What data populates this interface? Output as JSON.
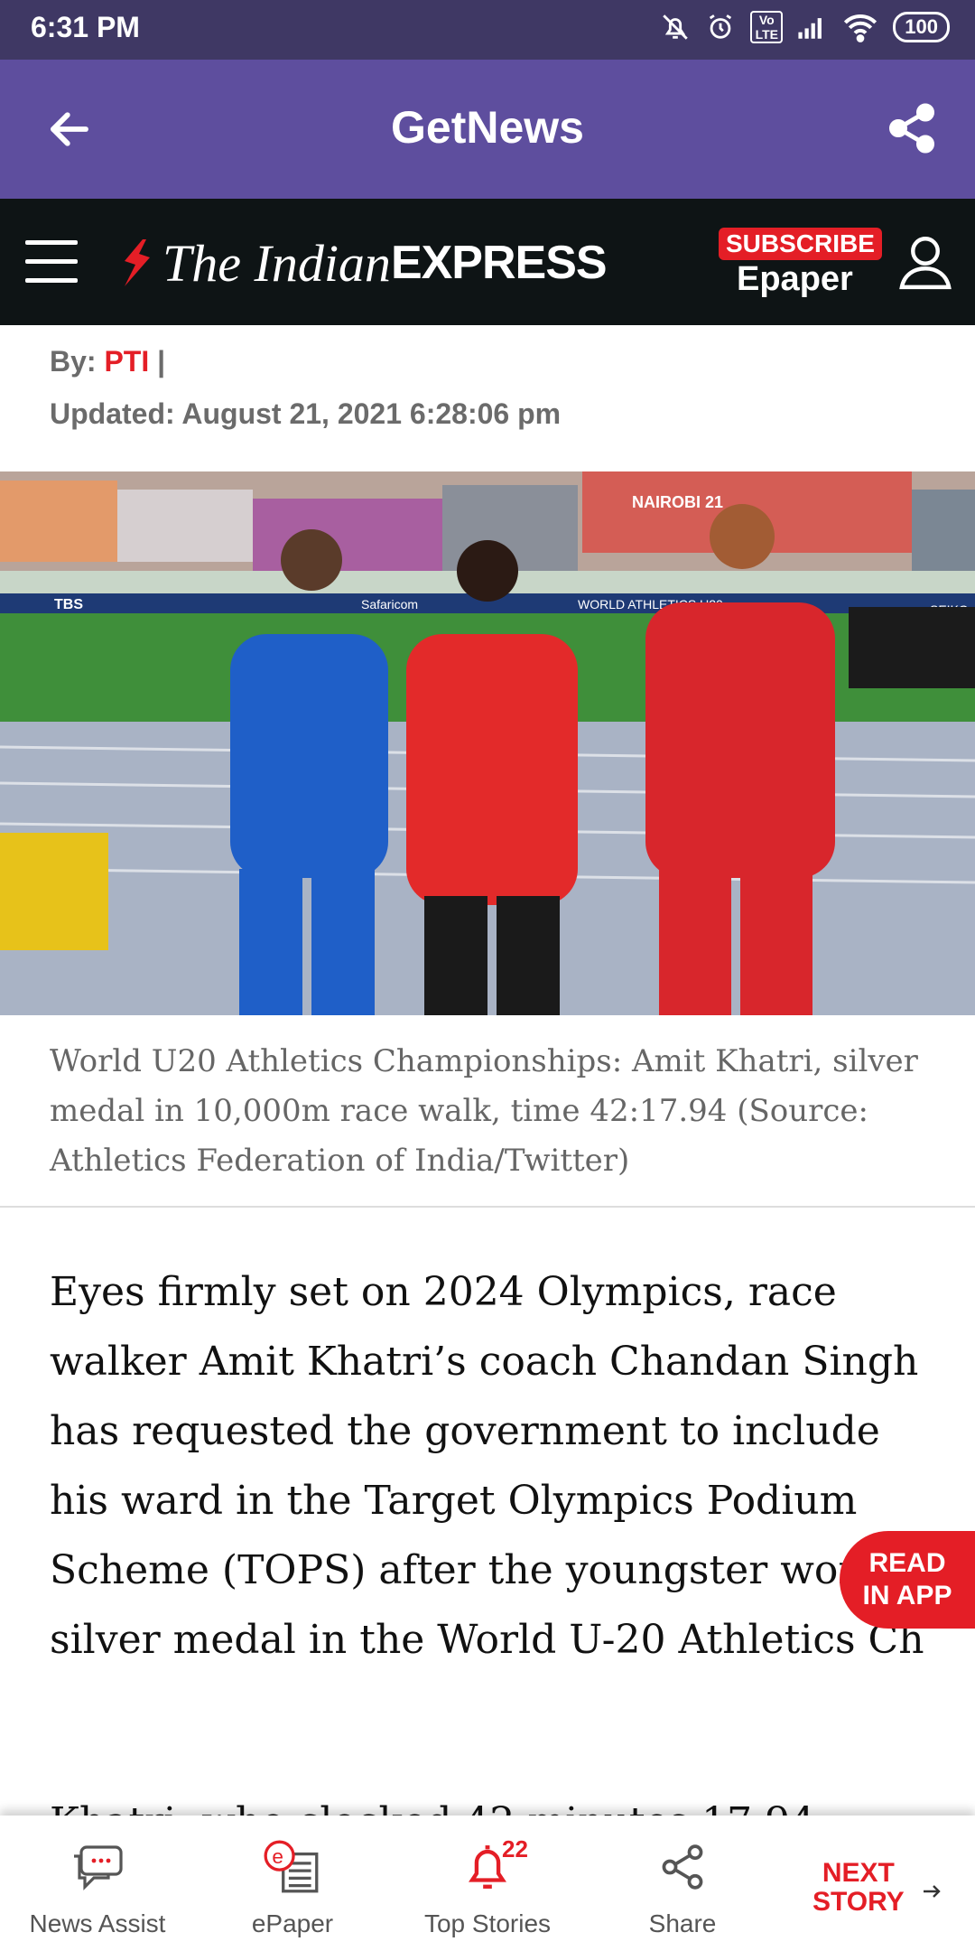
{
  "status_bar": {
    "time": "6:31 PM",
    "battery": "100",
    "network": "Vo LTE"
  },
  "app_bar": {
    "title": "GetNews"
  },
  "publisher_header": {
    "logo_the": "The Indian",
    "logo_express": "EXPRESS",
    "subscribe_label": "SUBSCRIBE",
    "epaper_label": "Epaper"
  },
  "article_meta": {
    "by_label": "By:",
    "author": "PTI",
    "separator": "|",
    "updated": "Updated: August 21, 2021 6:28:06 pm"
  },
  "hero": {
    "caption": "World U20 Athletics Championships: Amit Khatri, silver medal in 10,000m race walk, time 42:17.94 (Source: Athletics Federation of India/Twitter)",
    "signage": [
      "TBS",
      "Safaricom",
      "WORLD ATHLETICS U20",
      "NAIROBI 21",
      "SEIKO"
    ]
  },
  "article": {
    "paragraph_1": "Eyes firmly set on 2024 Olympics, race walker Amit Khatri’s coach Chandan Singh has requested the government to include his ward in the Target Olympics Podium Scheme (TOPS) after the youngster won silver medal in the World U-20 Athletics Ch",
    "paragraph_2_fragment": "Khatri, who clocked 42 minutes 17.94"
  },
  "read_in_app": {
    "line1": "READ",
    "line2": "IN APP"
  },
  "bottom_nav": {
    "items": [
      {
        "label": "News Assist",
        "icon": "chat-icon"
      },
      {
        "label": "ePaper",
        "icon": "epaper-icon"
      },
      {
        "label": "Top Stories",
        "icon": "bell-icon",
        "badge": "22"
      },
      {
        "label": "Share",
        "icon": "share-icon"
      }
    ],
    "next_story_line1": "NEXT",
    "next_story_line2": "STORY"
  },
  "colors": {
    "status_bar": "#3f3864",
    "app_bar": "#5e4e9e",
    "publisher_header": "#0e1415",
    "accent_red": "#e41e26"
  }
}
